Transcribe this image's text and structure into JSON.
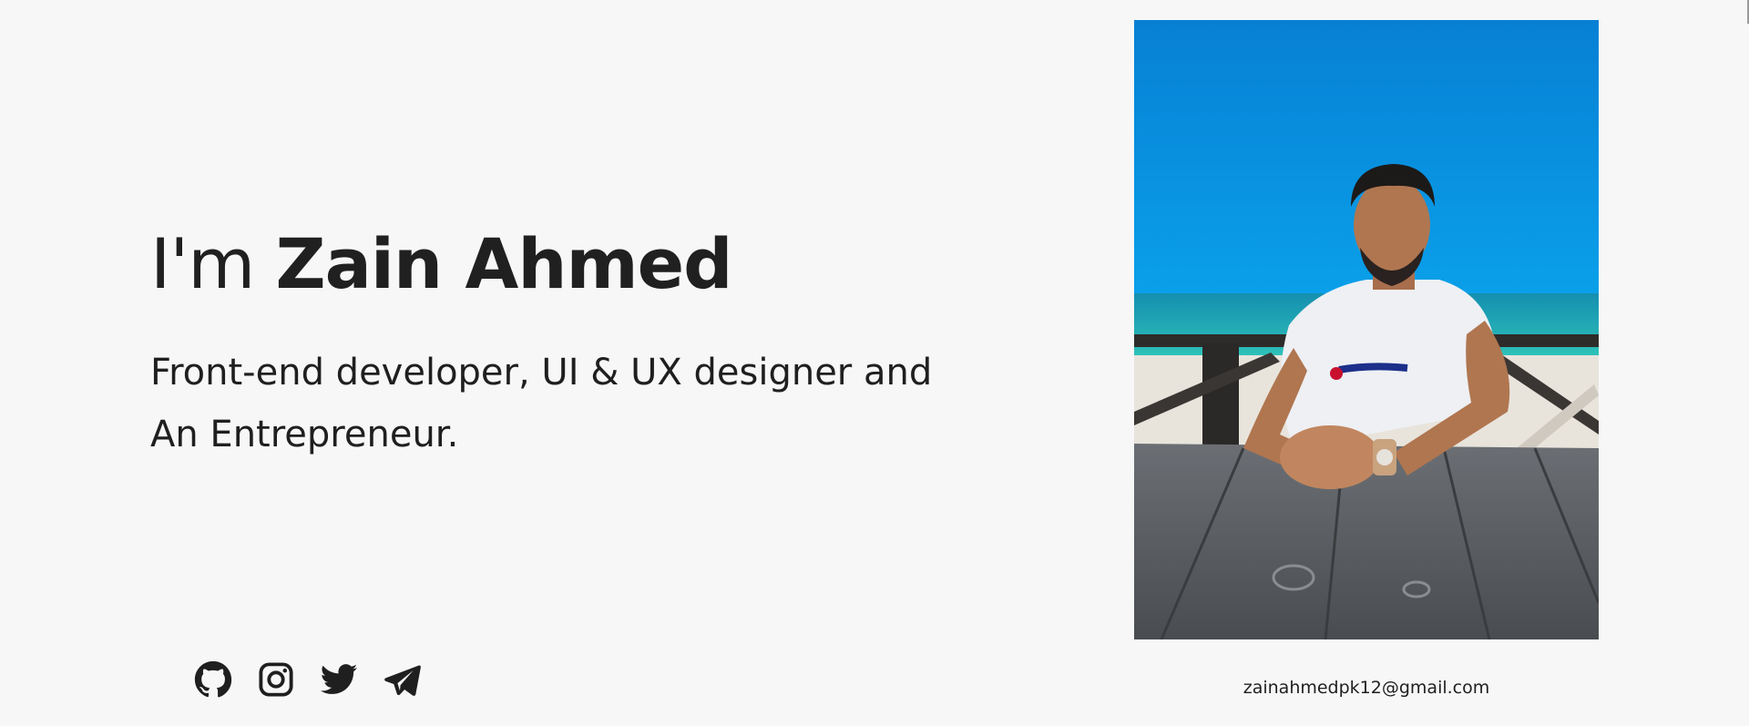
{
  "hero": {
    "greeting": "I'm",
    "name": "Zain Ahmed",
    "tagline_line1": "Front-end developer, UI & UX designer and",
    "tagline_line2": "An Entrepreneur."
  },
  "social": {
    "items": [
      {
        "icon": "github-icon"
      },
      {
        "icon": "instagram-icon"
      },
      {
        "icon": "twitter-icon"
      },
      {
        "icon": "telegram-icon"
      }
    ]
  },
  "profile": {
    "email": "zainahmedpk12@gmail.com"
  },
  "colors": {
    "background": "#f7f7f7",
    "text": "#1f1f1f",
    "sky": "#0a8fe0",
    "sea": "#1fb3b3"
  }
}
